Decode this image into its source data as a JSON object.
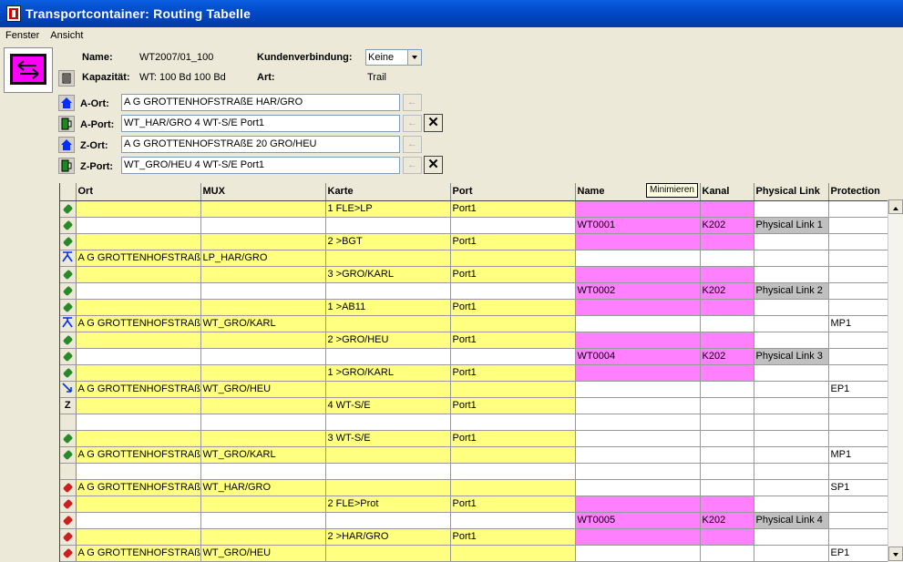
{
  "window": {
    "title": "Transportcontainer: Routing Tabelle"
  },
  "menu": [
    "Fenster",
    "Ansicht"
  ],
  "info": {
    "name_label": "Name:",
    "name_value": "WT2007/01_100",
    "kapazitaet_label": "Kapazität:",
    "kapazitaet_value": "WT: 100 Bd 100 Bd",
    "kunden_label": "Kundenverbindung:",
    "kunden_value": "Keine",
    "art_label": "Art:",
    "art_value": "Trail"
  },
  "endpoints": [
    {
      "label": "A-Ort:",
      "value": "A G GROTTENHOFSTRAßE HAR/GRO",
      "icon": "house-icon",
      "has_delete": false
    },
    {
      "label": "A-Port:",
      "value": "WT_HAR/GRO 4 WT-S/E Port1",
      "icon": "port-icon",
      "has_delete": true
    },
    {
      "label": "Z-Ort:",
      "value": "A G GROTTENHOFSTRAßE 20 GRO/HEU",
      "icon": "house-icon",
      "has_delete": false
    },
    {
      "label": "Z-Port:",
      "value": "WT_GRO/HEU 4 WT-S/E Port1",
      "icon": "port-icon",
      "has_delete": true
    }
  ],
  "tooltip": "Minimieren",
  "table": {
    "columns": [
      "",
      "Ort",
      "MUX",
      "Karte",
      "Port",
      "Name",
      "Kanal",
      "Physical Link",
      "Protection"
    ],
    "rows": [
      {
        "icon": "green",
        "ort": "",
        "mux": "",
        "karte": "1 FLE>LP",
        "port": "Port1",
        "name": "",
        "kanal": "",
        "plink": "",
        "prot": "",
        "y": true,
        "p": true
      },
      {
        "icon": "green",
        "ort": "",
        "mux": "",
        "karte": "",
        "port": "",
        "name": "WT0001",
        "kanal": "K202",
        "plink": "Physical Link 1",
        "prot": "",
        "y": false,
        "p": true
      },
      {
        "icon": "green",
        "ort": "",
        "mux": "",
        "karte": "2 >BGT",
        "port": "Port1",
        "name": "",
        "kanal": "",
        "plink": "",
        "prot": "",
        "y": true,
        "p": true
      },
      {
        "icon": "split",
        "ort": "A G GROTTENHOFSTRAß",
        "mux": "LP_HAR/GRO",
        "karte": "",
        "port": "",
        "name": "",
        "kanal": "",
        "plink": "",
        "prot": "",
        "y": true,
        "p": false
      },
      {
        "icon": "green",
        "ort": "",
        "mux": "",
        "karte": "3 >GRO/KARL",
        "port": "Port1",
        "name": "",
        "kanal": "",
        "plink": "",
        "prot": "",
        "y": true,
        "p": true
      },
      {
        "icon": "green",
        "ort": "",
        "mux": "",
        "karte": "",
        "port": "",
        "name": "WT0002",
        "kanal": "K202",
        "plink": "Physical Link 2",
        "prot": "",
        "y": false,
        "p": true
      },
      {
        "icon": "green",
        "ort": "",
        "mux": "",
        "karte": "1 >AB11",
        "port": "Port1",
        "name": "",
        "kanal": "",
        "plink": "",
        "prot": "",
        "y": true,
        "p": true
      },
      {
        "icon": "split",
        "ort": "A G GROTTENHOFSTRAß",
        "mux": "WT_GRO/KARL",
        "karte": "",
        "port": "",
        "name": "",
        "kanal": "",
        "plink": "",
        "prot": "MP1",
        "y": true,
        "p": false
      },
      {
        "icon": "green",
        "ort": "",
        "mux": "",
        "karte": "2 >GRO/HEU",
        "port": "Port1",
        "name": "",
        "kanal": "",
        "plink": "",
        "prot": "",
        "y": true,
        "p": true
      },
      {
        "icon": "green",
        "ort": "",
        "mux": "",
        "karte": "",
        "port": "",
        "name": "WT0004",
        "kanal": "K202",
        "plink": "Physical Link 3",
        "prot": "",
        "y": false,
        "p": true
      },
      {
        "icon": "green",
        "ort": "",
        "mux": "",
        "karte": "1 >GRO/KARL",
        "port": "Port1",
        "name": "",
        "kanal": "",
        "plink": "",
        "prot": "",
        "y": true,
        "p": true
      },
      {
        "icon": "end",
        "ort": "A G GROTTENHOFSTRAß",
        "mux": "WT_GRO/HEU",
        "karte": "",
        "port": "",
        "name": "",
        "kanal": "",
        "plink": "",
        "prot": "EP1",
        "y": true,
        "p": false
      },
      {
        "icon": "z",
        "ort": "",
        "mux": "",
        "karte": "4 WT-S/E",
        "port": "Port1",
        "name": "",
        "kanal": "",
        "plink": "",
        "prot": "",
        "y": true,
        "p": false
      },
      {
        "icon": "none",
        "ort": "",
        "mux": "",
        "karte": "",
        "port": "",
        "name": "",
        "kanal": "",
        "plink": "",
        "prot": "",
        "y": false,
        "p": false
      },
      {
        "icon": "green",
        "ort": "",
        "mux": "",
        "karte": "3 WT-S/E",
        "port": "Port1",
        "name": "",
        "kanal": "",
        "plink": "",
        "prot": "",
        "y": true,
        "p": false
      },
      {
        "icon": "green",
        "ort": "A G GROTTENHOFSTRAß",
        "mux": "WT_GRO/KARL",
        "karte": "",
        "port": "",
        "name": "",
        "kanal": "",
        "plink": "",
        "prot": "MP1",
        "y": true,
        "p": false
      },
      {
        "icon": "none",
        "ort": "",
        "mux": "",
        "karte": "",
        "port": "",
        "name": "",
        "kanal": "",
        "plink": "",
        "prot": "",
        "y": false,
        "p": false
      },
      {
        "icon": "red",
        "ort": "A G GROTTENHOFSTRAß",
        "mux": "WT_HAR/GRO",
        "karte": "",
        "port": "",
        "name": "",
        "kanal": "",
        "plink": "",
        "prot": "SP1",
        "y": true,
        "p": false
      },
      {
        "icon": "red",
        "ort": "",
        "mux": "",
        "karte": "2 FLE>Prot",
        "port": "Port1",
        "name": "",
        "kanal": "",
        "plink": "",
        "prot": "",
        "y": true,
        "p": true
      },
      {
        "icon": "red",
        "ort": "",
        "mux": "",
        "karte": "",
        "port": "",
        "name": "WT0005",
        "kanal": "K202",
        "plink": "Physical Link 4",
        "prot": "",
        "y": false,
        "p": true
      },
      {
        "icon": "red",
        "ort": "",
        "mux": "",
        "karte": "2 >HAR/GRO",
        "port": "Port1",
        "name": "",
        "kanal": "",
        "plink": "",
        "prot": "",
        "y": true,
        "p": true
      },
      {
        "icon": "red",
        "ort": "A G GROTTENHOFSTRAß",
        "mux": "WT_GRO/HEU",
        "karte": "",
        "port": "",
        "name": "",
        "kanal": "",
        "plink": "",
        "prot": "EP1",
        "y": true,
        "p": false
      }
    ]
  },
  "colors": {
    "yellow": "#ffff80",
    "pink": "#ff80ff",
    "grey": "#c0c0c0"
  }
}
